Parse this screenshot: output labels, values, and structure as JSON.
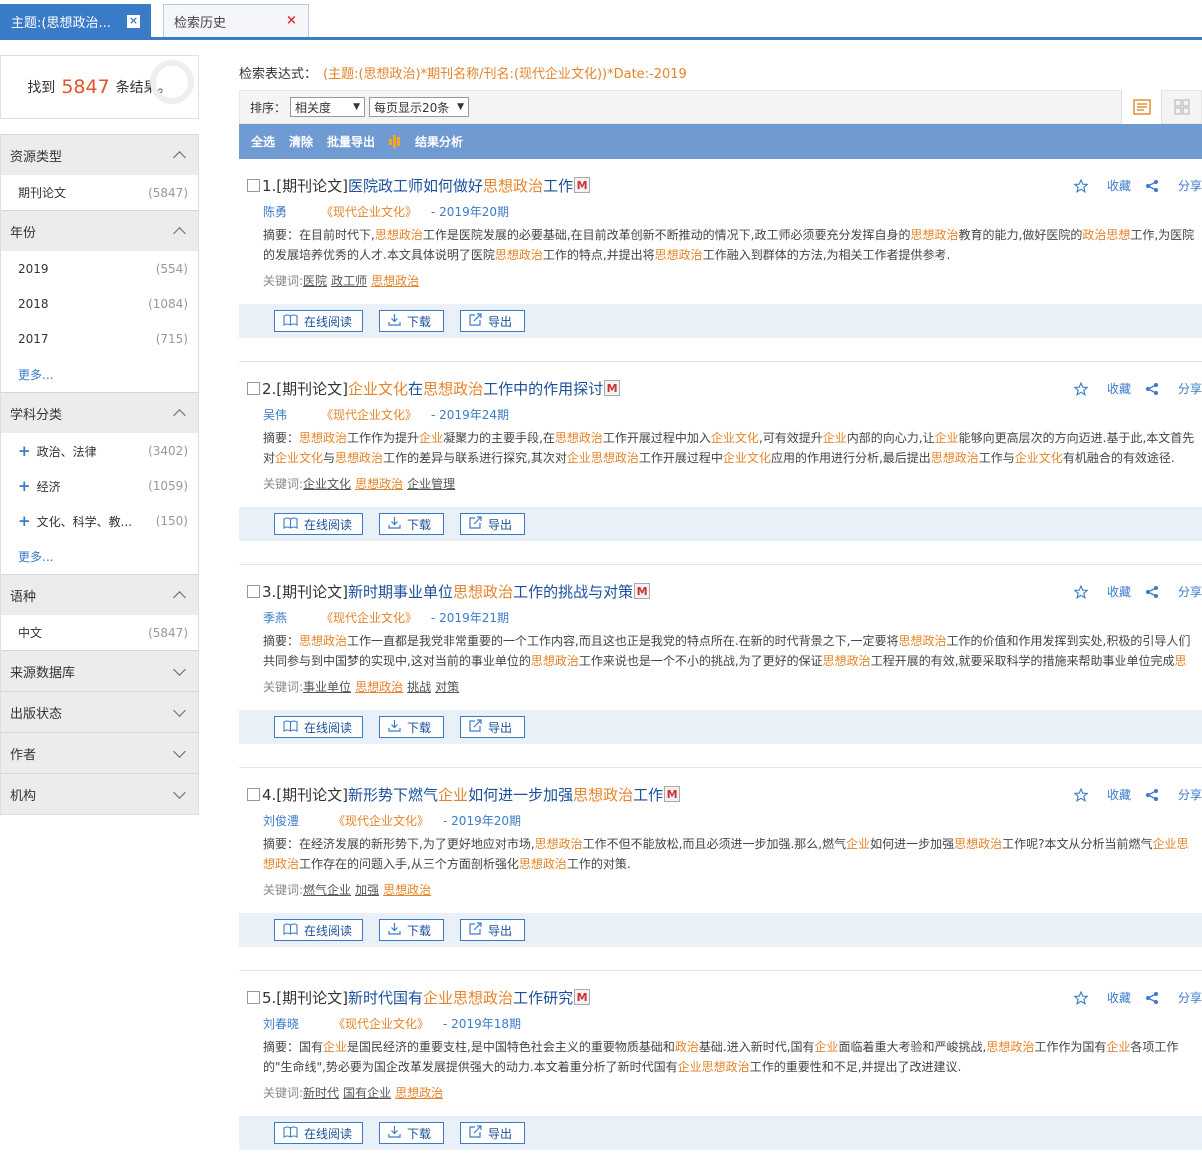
{
  "tabs": [
    {
      "label": "主题:(思想政治...",
      "close": "×"
    },
    {
      "label": "检索历史",
      "close": "×"
    }
  ],
  "summary": {
    "prefix": "找到",
    "count": "5847",
    "suffix": "条结果。"
  },
  "facets": [
    {
      "title": "资源类型",
      "expanded": true,
      "items": [
        {
          "label": "期刊论文",
          "count": "(5847)"
        }
      ]
    },
    {
      "title": "年份",
      "expanded": true,
      "items": [
        {
          "label": "2019",
          "count": "(554)"
        },
        {
          "label": "2018",
          "count": "(1084)"
        },
        {
          "label": "2017",
          "count": "(715)"
        }
      ],
      "more": "更多..."
    },
    {
      "title": "学科分类",
      "expanded": true,
      "items": [
        {
          "label": "政治、法律",
          "count": "(3402)",
          "plus": true
        },
        {
          "label": "经济",
          "count": "(1059)",
          "plus": true
        },
        {
          "label": "文化、科学、教...",
          "count": "(150)",
          "plus": true
        }
      ],
      "more": "更多..."
    },
    {
      "title": "语种",
      "expanded": true,
      "items": [
        {
          "label": "中文",
          "count": "(5847)"
        }
      ]
    },
    {
      "title": "来源数据库",
      "expanded": false
    },
    {
      "title": "出版状态",
      "expanded": false
    },
    {
      "title": "作者",
      "expanded": false
    },
    {
      "title": "机构",
      "expanded": false
    }
  ],
  "expression": {
    "label": "检索表达式：",
    "value": "(主题:(思想政治)*期刊名称/刊名:(现代企业文化))*Date:-2019"
  },
  "sort": {
    "label": "排序：",
    "sort_value": "相关度",
    "per_page_value": "每页显示20条",
    "tri": "▼"
  },
  "actions": {
    "select_all": "全选",
    "clear": "清除",
    "batch_export": "批量导出",
    "analysis": "结果分析"
  },
  "item_ops": {
    "favorite": "收藏",
    "share": "分享"
  },
  "item_buttons": {
    "read": "在线阅读",
    "download": "下载",
    "export": "导出"
  },
  "keywords_label": "关键词:",
  "results": [
    {
      "prefix": "1.[期刊论文]",
      "title_parts": [
        {
          "t": "医院政工师如何做好",
          "hl": false
        },
        {
          "t": "思想政治",
          "hl": true
        },
        {
          "t": "工作",
          "hl": false
        }
      ],
      "author": "陈勇",
      "journal": "《现代企业文化》",
      "issue": "- 2019年20期",
      "abstract_parts": [
        {
          "t": "摘要：在目前时代下,",
          "hl": false
        },
        {
          "t": "思想政治",
          "hl": true
        },
        {
          "t": "工作是医院发展的必要基础,在目前改革创新不断推动的情况下,政工师必须要充分发挥自身的",
          "hl": false
        },
        {
          "t": "思想政治",
          "hl": true
        },
        {
          "t": "教育的能力,做好医院的",
          "hl": false
        },
        {
          "t": "政治思想",
          "hl": true
        },
        {
          "t": "工作,为医院的发展培养优秀的人才.本文具体说明了医院",
          "hl": false
        },
        {
          "t": "思想政治",
          "hl": true
        },
        {
          "t": "工作的特点,并提出将",
          "hl": false
        },
        {
          "t": "思想政治",
          "hl": true
        },
        {
          "t": "工作融入到群体的方法,为相关工作者提供参考.",
          "hl": false
        }
      ],
      "keywords": [
        {
          "t": "医院",
          "hl": false
        },
        {
          "t": "政工师",
          "hl": false
        },
        {
          "t": "思想政治",
          "hl": true
        }
      ]
    },
    {
      "prefix": "2.[期刊论文]",
      "title_parts": [
        {
          "t": "企业文化",
          "hl": true
        },
        {
          "t": "在",
          "hl": false
        },
        {
          "t": "思想政治",
          "hl": true
        },
        {
          "t": "工作中的作用探讨",
          "hl": false
        }
      ],
      "author": "吴伟",
      "journal": "《现代企业文化》",
      "issue": "- 2019年24期",
      "abstract_parts": [
        {
          "t": "摘要：",
          "hl": false
        },
        {
          "t": "思想政治",
          "hl": true
        },
        {
          "t": "工作作为提升",
          "hl": false
        },
        {
          "t": "企业",
          "hl": true
        },
        {
          "t": "凝聚力的主要手段,在",
          "hl": false
        },
        {
          "t": "思想政治",
          "hl": true
        },
        {
          "t": "工作开展过程中加入",
          "hl": false
        },
        {
          "t": "企业文化",
          "hl": true
        },
        {
          "t": ",可有效提升",
          "hl": false
        },
        {
          "t": "企业",
          "hl": true
        },
        {
          "t": "内部的向心力,让",
          "hl": false
        },
        {
          "t": "企业",
          "hl": true
        },
        {
          "t": "能够向更高层次的方向迈进.基于此,本文首先对",
          "hl": false
        },
        {
          "t": "企业文化",
          "hl": true
        },
        {
          "t": "与",
          "hl": false
        },
        {
          "t": "思想政治",
          "hl": true
        },
        {
          "t": "工作的差异与联系进行探究,其次对",
          "hl": false
        },
        {
          "t": "企业思想政治",
          "hl": true
        },
        {
          "t": "工作开展过程中",
          "hl": false
        },
        {
          "t": "企业文化",
          "hl": true
        },
        {
          "t": "应用的作用进行分析,最后提出",
          "hl": false
        },
        {
          "t": "思想政治",
          "hl": true
        },
        {
          "t": "工作与",
          "hl": false
        },
        {
          "t": "企业文化",
          "hl": true
        },
        {
          "t": "有机融合的有效途径.",
          "hl": false
        }
      ],
      "keywords": [
        {
          "t": "企业文化",
          "hl": false
        },
        {
          "t": "思想政治",
          "hl": true
        },
        {
          "t": "企业管理",
          "hl": false
        }
      ]
    },
    {
      "prefix": "3.[期刊论文]",
      "title_parts": [
        {
          "t": "新时期事业单位",
          "hl": false
        },
        {
          "t": "思想政治",
          "hl": true
        },
        {
          "t": "工作的挑战与对策",
          "hl": false
        }
      ],
      "author": "季燕",
      "journal": "《现代企业文化》",
      "issue": "- 2019年21期",
      "abstract_parts": [
        {
          "t": "摘要：",
          "hl": false
        },
        {
          "t": "思想政治",
          "hl": true
        },
        {
          "t": "工作一直都是我党非常重要的一个工作内容,而且这也正是我党的特点所在.在新的时代背景之下,一定要将",
          "hl": false
        },
        {
          "t": "思想政治",
          "hl": true
        },
        {
          "t": "工作的价值和作用发挥到实处,积极的引导人们共同参与到中国梦的实现中,这对当前的事业单位的",
          "hl": false
        },
        {
          "t": "思想政治",
          "hl": true
        },
        {
          "t": "工作来说也是一个不小的挑战,为了更好的保证",
          "hl": false
        },
        {
          "t": "思想政治",
          "hl": true
        },
        {
          "t": "工程开展的有效,就要采取科学的措施来帮助事业单位完成",
          "hl": false
        },
        {
          "t": "思想...",
          "hl": true
        }
      ],
      "keywords": [
        {
          "t": "事业单位",
          "hl": false
        },
        {
          "t": "思想政治",
          "hl": true
        },
        {
          "t": "挑战",
          "hl": false
        },
        {
          "t": "对策",
          "hl": false
        }
      ]
    },
    {
      "prefix": "4.[期刊论文]",
      "title_parts": [
        {
          "t": "新形势下燃气",
          "hl": false
        },
        {
          "t": "企业",
          "hl": true
        },
        {
          "t": "如何进一步加强",
          "hl": false
        },
        {
          "t": "思想政治",
          "hl": true
        },
        {
          "t": "工作",
          "hl": false
        }
      ],
      "author": "刘俊澧",
      "journal": "《现代企业文化》",
      "issue": "- 2019年20期",
      "abstract_parts": [
        {
          "t": "摘要：在经济发展的新形势下,为了更好地应对市场,",
          "hl": false
        },
        {
          "t": "思想政治",
          "hl": true
        },
        {
          "t": "工作不但不能放松,而且必须进一步加强.那么,燃气",
          "hl": false
        },
        {
          "t": "企业",
          "hl": true
        },
        {
          "t": "如何进一步加强",
          "hl": false
        },
        {
          "t": "思想政治",
          "hl": true
        },
        {
          "t": "工作呢?本文从分析当前燃气",
          "hl": false
        },
        {
          "t": "企业思想政治",
          "hl": true
        },
        {
          "t": "工作存在的问题入手,从三个方面剖析强化",
          "hl": false
        },
        {
          "t": "思想政治",
          "hl": true
        },
        {
          "t": "工作的对策.",
          "hl": false
        }
      ],
      "keywords": [
        {
          "t": "燃气企业",
          "hl": false
        },
        {
          "t": "加强",
          "hl": false
        },
        {
          "t": "思想政治",
          "hl": true
        }
      ]
    },
    {
      "prefix": "5.[期刊论文]",
      "title_parts": [
        {
          "t": "新时代国有",
          "hl": false
        },
        {
          "t": "企业思想政治",
          "hl": true
        },
        {
          "t": "工作研究",
          "hl": false
        }
      ],
      "author": "刘春晓",
      "journal": "《现代企业文化》",
      "issue": "- 2019年18期",
      "abstract_parts": [
        {
          "t": "摘要：国有",
          "hl": false
        },
        {
          "t": "企业",
          "hl": true
        },
        {
          "t": "是国民经济的重要支柱,是中国特色社会主义的重要物质基础和",
          "hl": false
        },
        {
          "t": "政治",
          "hl": true
        },
        {
          "t": "基础.进入新时代,国有",
          "hl": false
        },
        {
          "t": "企业",
          "hl": true
        },
        {
          "t": "面临着重大考验和严峻挑战,",
          "hl": false
        },
        {
          "t": "思想政治",
          "hl": true
        },
        {
          "t": "工作作为国有",
          "hl": false
        },
        {
          "t": "企业",
          "hl": true
        },
        {
          "t": "各项工作的\"生命线\",势必要为国企改革发展提供强大的动力.本文着重分析了新时代国有",
          "hl": false
        },
        {
          "t": "企业思想政治",
          "hl": true
        },
        {
          "t": "工作的重要性和不足,并提出了改进建议.",
          "hl": false
        }
      ],
      "keywords": [
        {
          "t": "新时代",
          "hl": false
        },
        {
          "t": "国有企业",
          "hl": false
        },
        {
          "t": "思想政治",
          "hl": true
        }
      ]
    }
  ]
}
